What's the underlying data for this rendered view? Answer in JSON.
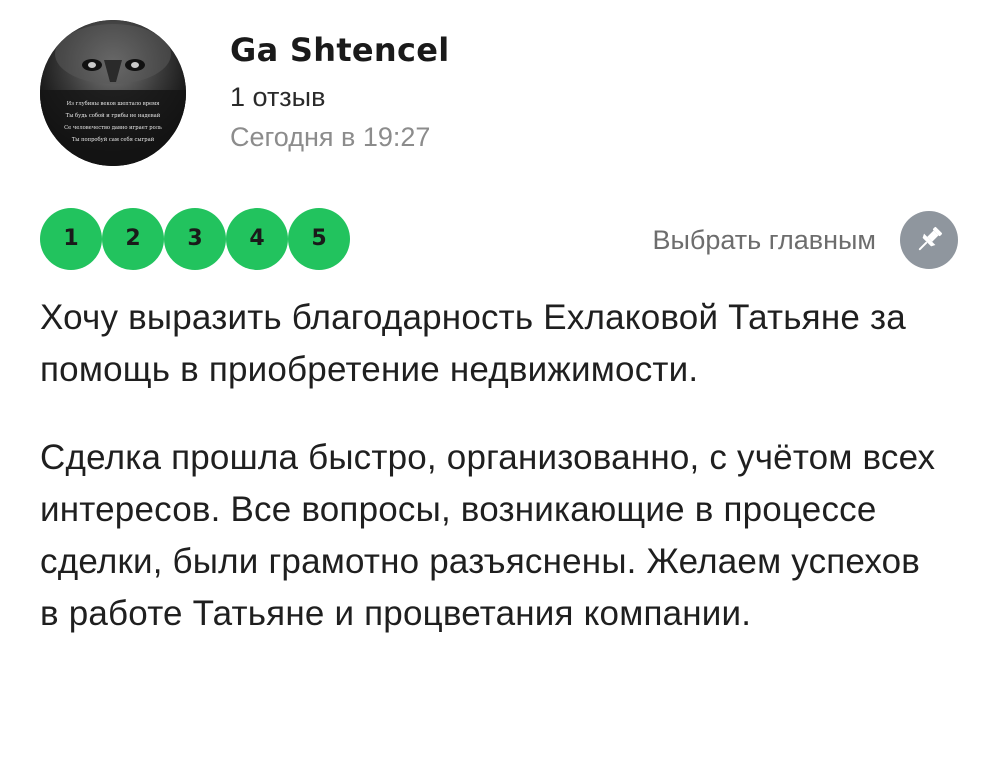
{
  "review": {
    "author_name": "Ga Shtencel",
    "review_count": "1 отзыв",
    "date": "Сегодня в 19:27",
    "avatar_lines": [
      "Из глубины веков шептало время",
      "Ты будь собой и грибы не надевай",
      "Се человечество давно играет роль",
      "Ты попробуй сам себя сыграй"
    ],
    "rating_labels": [
      "1",
      "2",
      "3",
      "4",
      "5"
    ],
    "rating_value": 5,
    "rating_color": "#22c35e",
    "pick_main_label": "Выбрать главным",
    "pin_icon": "pushpin-icon",
    "paragraphs": [
      "Хочу выразить благодарность Ехлаковой Татьяне за помощь в приобретение недвижимости.",
      "Сделка прошла быстро, организованно, с учётом всех интересов. Все вопросы, возникающие в процессе сделки, были грамотно разъяснены. Желаем успехов в работе Татьяне и процветания компании."
    ]
  }
}
